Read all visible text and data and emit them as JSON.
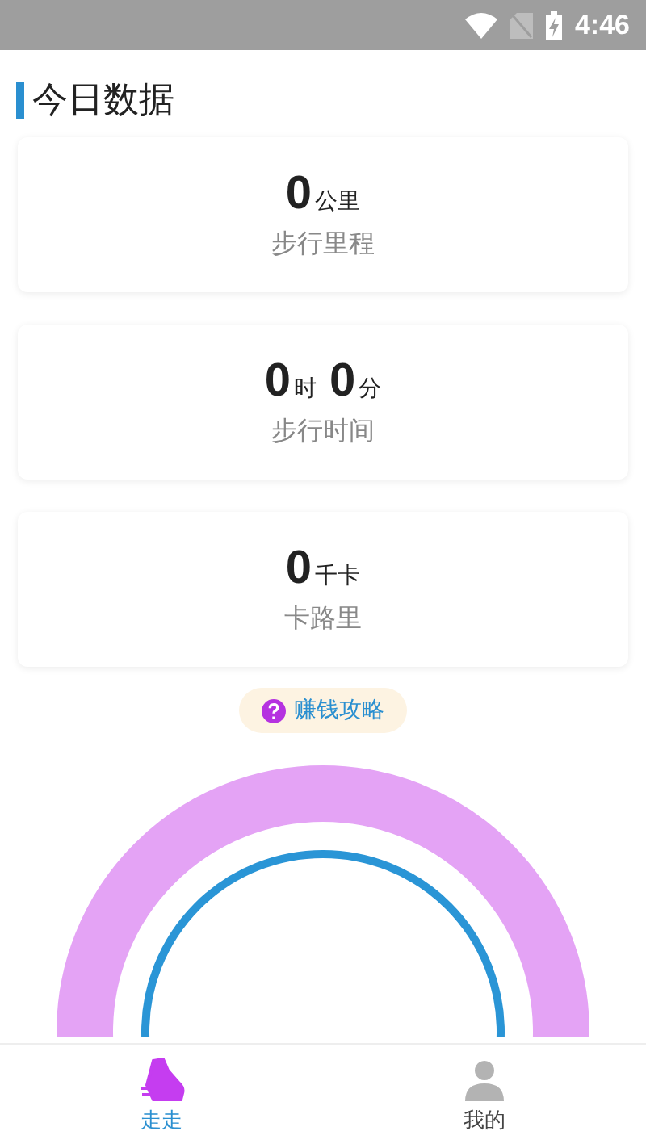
{
  "status_bar": {
    "time": "4:46"
  },
  "title": "今日数据",
  "cards": [
    {
      "parts": [
        {
          "value": "0",
          "unit": "公里"
        }
      ],
      "label": "步行里程"
    },
    {
      "parts": [
        {
          "value": "0",
          "unit": "时"
        },
        {
          "value": "0",
          "unit": "分"
        }
      ],
      "label": "步行时间"
    },
    {
      "parts": [
        {
          "value": "0",
          "unit": "千卡"
        }
      ],
      "label": "卡路里"
    }
  ],
  "tip": {
    "text": "赚钱攻略"
  },
  "nav": [
    {
      "label": "走走",
      "kind": "walk",
      "selected": true
    },
    {
      "label": "我的",
      "kind": "profile",
      "selected": false
    }
  ]
}
